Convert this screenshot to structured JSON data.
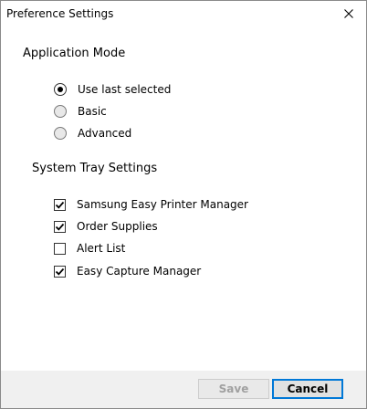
{
  "window": {
    "title": "Preference Settings"
  },
  "application_mode": {
    "title": "Application Mode",
    "options": [
      {
        "label": "Use last selected",
        "selected": true
      },
      {
        "label": "Basic",
        "selected": false
      },
      {
        "label": "Advanced",
        "selected": false
      }
    ]
  },
  "system_tray": {
    "title": "System Tray Settings",
    "items": [
      {
        "label": "Samsung Easy Printer Manager",
        "checked": true
      },
      {
        "label": "Order Supplies",
        "checked": true
      },
      {
        "label": "Alert List",
        "checked": false
      },
      {
        "label": "Easy Capture Manager",
        "checked": true
      }
    ]
  },
  "footer": {
    "save_label": "Save",
    "cancel_label": "Cancel"
  },
  "colors": {
    "focus_border": "#0078d7",
    "disabled_text": "#a0a0a0",
    "footer_bg": "#f0f0f0"
  }
}
